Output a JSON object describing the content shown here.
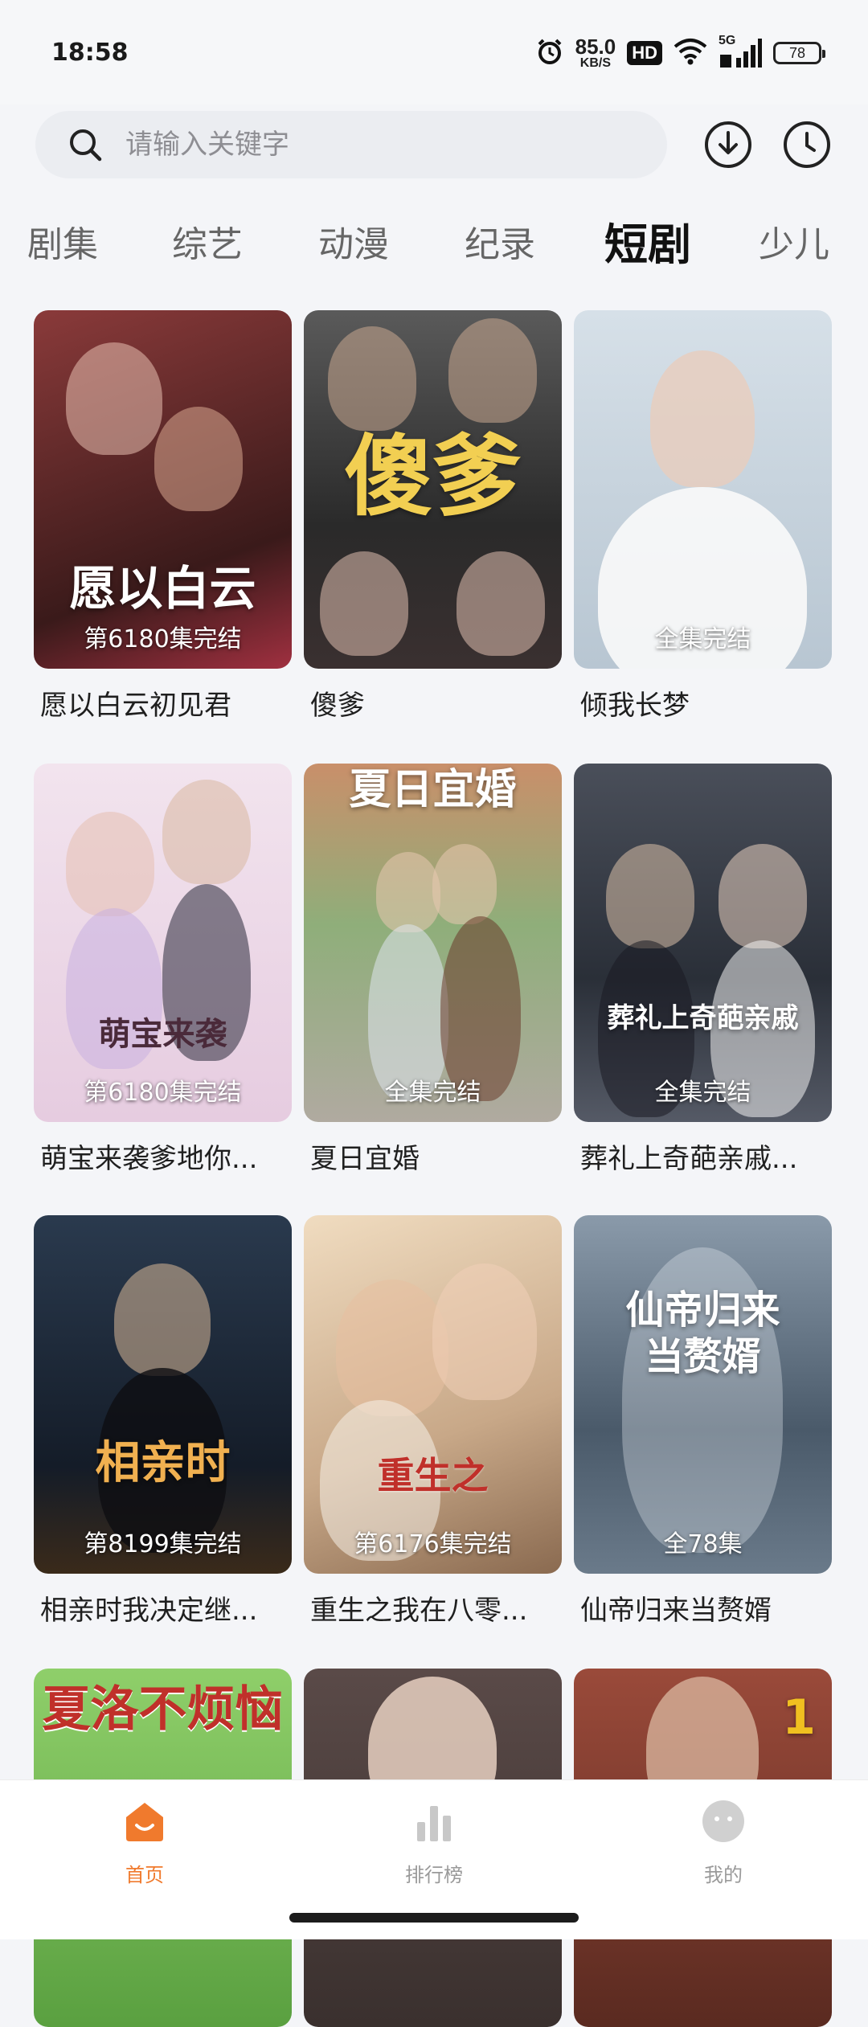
{
  "status_bar": {
    "time": "18:58",
    "net_speed_value": "85.0",
    "net_speed_unit": "KB/S",
    "hd": "HD",
    "signal": "5G",
    "battery": "78"
  },
  "search": {
    "placeholder": "请输入关键字"
  },
  "header_icons": [
    "download-icon",
    "history-icon"
  ],
  "tabs": {
    "items": [
      {
        "label": "剧集"
      },
      {
        "label": "综艺"
      },
      {
        "label": "动漫"
      },
      {
        "label": "纪录"
      },
      {
        "label": "短剧"
      },
      {
        "label": "少儿"
      }
    ],
    "active": "短剧"
  },
  "videos": [
    {
      "title": "愿以白云初见君",
      "badge": "第6180集完结",
      "poster_text": "愿以白云",
      "bg": "#6b2a2a",
      "accent": "#d94a4a"
    },
    {
      "title": "傻爹",
      "badge": "",
      "poster_text": "傻爹",
      "bg": "#4a4a4a",
      "accent": "#e8c24a"
    },
    {
      "title": "倾我长梦",
      "badge": "全集完结",
      "poster_text": "",
      "bg": "#cdd7e0",
      "accent": "#f2f4f6"
    },
    {
      "title": "萌宝来袭爹地你...",
      "badge": "第6180集完结",
      "poster_text": "萌宝来袭",
      "bg": "#e8d0e0",
      "accent": "#c8a4d8"
    },
    {
      "title": "夏日宜婚",
      "badge": "全集完结",
      "poster_text": "夏日宜婚",
      "bg": "#c98f6a",
      "accent": "#7fbf7a"
    },
    {
      "title": "葬礼上奇葩亲戚...",
      "badge": "全集完结",
      "poster_text": "葬礼上奇葩亲戚",
      "bg": "#3a3f4a",
      "accent": "#8a9aaa"
    },
    {
      "title": "相亲时我决定继...",
      "badge": "第8199集完结",
      "poster_text": "相亲时",
      "bg": "#1f2a3a",
      "accent": "#e8a04a"
    },
    {
      "title": "重生之我在八零...",
      "badge": "第6176集完结",
      "poster_text": "重生之",
      "bg": "#e0c8a8",
      "accent": "#c0302a"
    },
    {
      "title": "仙帝归来当赘婿",
      "badge": "全78集",
      "poster_text": "仙帝归来当赘婿",
      "bg": "#6a7a8a",
      "accent": "#dfe6ee"
    },
    {
      "title": "",
      "badge": "",
      "poster_text": "夏洛不烦恼",
      "bg": "#7fbf5a",
      "accent": "#c0302a"
    },
    {
      "title": "",
      "badge": "",
      "poster_text": "",
      "bg": "#5a4a48",
      "accent": "#f0d8c8"
    },
    {
      "title": "",
      "badge": "",
      "poster_text": "1",
      "bg": "#8a3a2a",
      "accent": "#f0c020"
    }
  ],
  "bottom_nav": [
    {
      "label": "首页",
      "icon": "home-icon",
      "active": true
    },
    {
      "label": "排行榜",
      "icon": "ranking-icon",
      "active": false
    },
    {
      "label": "我的",
      "icon": "profile-icon",
      "active": false
    }
  ],
  "colors": {
    "accent": "#f07a2d",
    "background": "#f4f5f8"
  }
}
